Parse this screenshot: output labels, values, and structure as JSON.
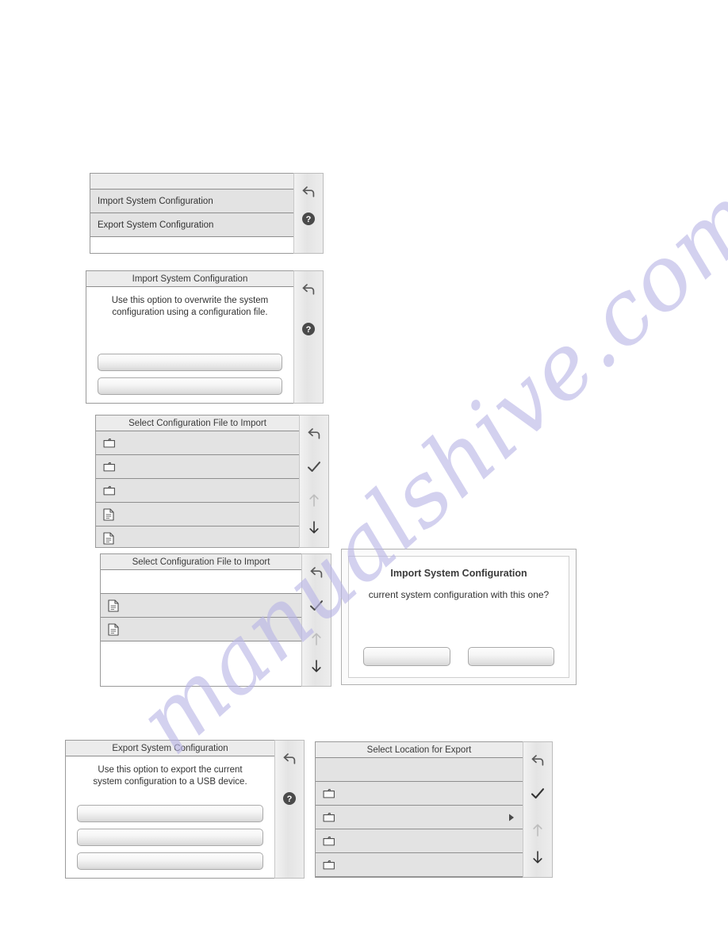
{
  "page": {
    "watermark": "manualshive.com"
  },
  "screens": {
    "menu": {
      "title": "",
      "rows": [
        {
          "label": "Import System Configuration"
        },
        {
          "label": "Export System Configuration"
        }
      ],
      "sidebar": [
        {
          "icon": "back-arrow-icon",
          "state": "enabled"
        },
        {
          "icon": "help-icon",
          "state": "enabled"
        }
      ]
    },
    "import_info": {
      "title": "Import System Configuration",
      "body_text": "Use this option to overwrite the system\nconfiguration using a configuration file.",
      "buttons": [
        {
          "label": ""
        },
        {
          "label": ""
        }
      ],
      "sidebar": [
        {
          "icon": "back-arrow-icon",
          "state": "enabled"
        },
        {
          "icon": "help-icon",
          "state": "enabled"
        }
      ]
    },
    "select_file_a": {
      "title": "Select Configuration File to Import",
      "rows": [
        {
          "icon": "folder-icon",
          "label": ""
        },
        {
          "icon": "folder-icon",
          "label": ""
        },
        {
          "icon": "folder-icon",
          "label": ""
        },
        {
          "icon": "file-icon",
          "label": ""
        },
        {
          "icon": "file-icon",
          "label": ""
        }
      ],
      "sidebar": [
        {
          "icon": "back-arrow-icon",
          "state": "enabled"
        },
        {
          "icon": "check-icon",
          "state": "enabled"
        },
        {
          "icon": "arrow-up-icon",
          "state": "disabled"
        },
        {
          "icon": "arrow-down-icon",
          "state": "enabled"
        }
      ]
    },
    "select_file_b": {
      "title": "Select Configuration File to Import",
      "rows": [
        {
          "icon": "none",
          "label": ""
        },
        {
          "icon": "file-icon",
          "label": ""
        },
        {
          "icon": "file-icon",
          "label": ""
        }
      ],
      "sidebar": [
        {
          "icon": "back-arrow-icon",
          "state": "enabled"
        },
        {
          "icon": "check-icon",
          "state": "enabled"
        },
        {
          "icon": "arrow-up-icon",
          "state": "disabled"
        },
        {
          "icon": "arrow-down-icon",
          "state": "enabled"
        }
      ]
    },
    "confirm_dialog": {
      "title": "Import System Configuration",
      "message": "current system configuration with this one?",
      "buttons": [
        {
          "label": ""
        },
        {
          "label": ""
        }
      ]
    },
    "export_info": {
      "title": "Export System Configuration",
      "body_text": "Use this option to export the current\nsystem configuration to a USB device.",
      "buttons": [
        {
          "label": ""
        },
        {
          "label": ""
        },
        {
          "label": ""
        }
      ],
      "sidebar": [
        {
          "icon": "back-arrow-icon",
          "state": "enabled"
        },
        {
          "icon": "help-icon",
          "state": "enabled"
        }
      ]
    },
    "select_location": {
      "title": "Select Location for Export",
      "rows": [
        {
          "icon": "none",
          "label": "",
          "chevron": false
        },
        {
          "icon": "folder-icon",
          "label": "",
          "chevron": false
        },
        {
          "icon": "folder-icon",
          "label": "",
          "chevron": true
        },
        {
          "icon": "folder-icon",
          "label": "",
          "chevron": false
        },
        {
          "icon": "folder-icon",
          "label": "",
          "chevron": false
        }
      ],
      "sidebar": [
        {
          "icon": "back-arrow-icon",
          "state": "enabled"
        },
        {
          "icon": "check-icon",
          "state": "enabled"
        },
        {
          "icon": "arrow-up-icon",
          "state": "disabled"
        },
        {
          "icon": "arrow-down-icon",
          "state": "enabled"
        }
      ]
    }
  },
  "colors": {
    "row_fill": "#e3e3e3",
    "row_border": "#8e8e8e",
    "sidebar_fill": "#e9e9e9",
    "watermark": "#b9b5e6",
    "text": "#333333"
  }
}
